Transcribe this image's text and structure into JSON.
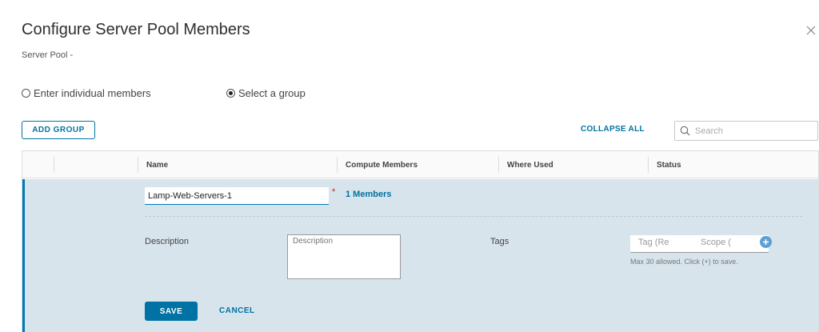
{
  "dialog": {
    "title": "Configure Server Pool Members",
    "subtitle": "Server Pool -"
  },
  "mode": {
    "options": [
      {
        "label": "Enter individual members",
        "selected": false
      },
      {
        "label": "Select a group",
        "selected": true
      }
    ]
  },
  "toolbar": {
    "add_group_label": "ADD GROUP",
    "collapse_all_label": "COLLAPSE ALL",
    "search_placeholder": "Search"
  },
  "grid": {
    "columns": [
      "Name",
      "Compute Members",
      "Where Used",
      "Status"
    ],
    "row": {
      "name_value": "Lamp-Web-Servers-1",
      "required_mark": "*",
      "members_label": "1 Members",
      "description_label": "Description",
      "description_placeholder": "Description",
      "tags_label": "Tags",
      "tag_placeholder": "Tag (Re",
      "scope_placeholder": "Scope (",
      "tags_help": "Max 30 allowed. Click (+) to save.",
      "save_label": "SAVE",
      "cancel_label": "CANCEL"
    }
  },
  "icons": {
    "close": "close-icon",
    "search": "search-icon",
    "add_tag": "plus-circle-icon"
  },
  "colors": {
    "accent": "#0072a3",
    "row_bg": "#d7e4ec",
    "required": "#c92100"
  }
}
